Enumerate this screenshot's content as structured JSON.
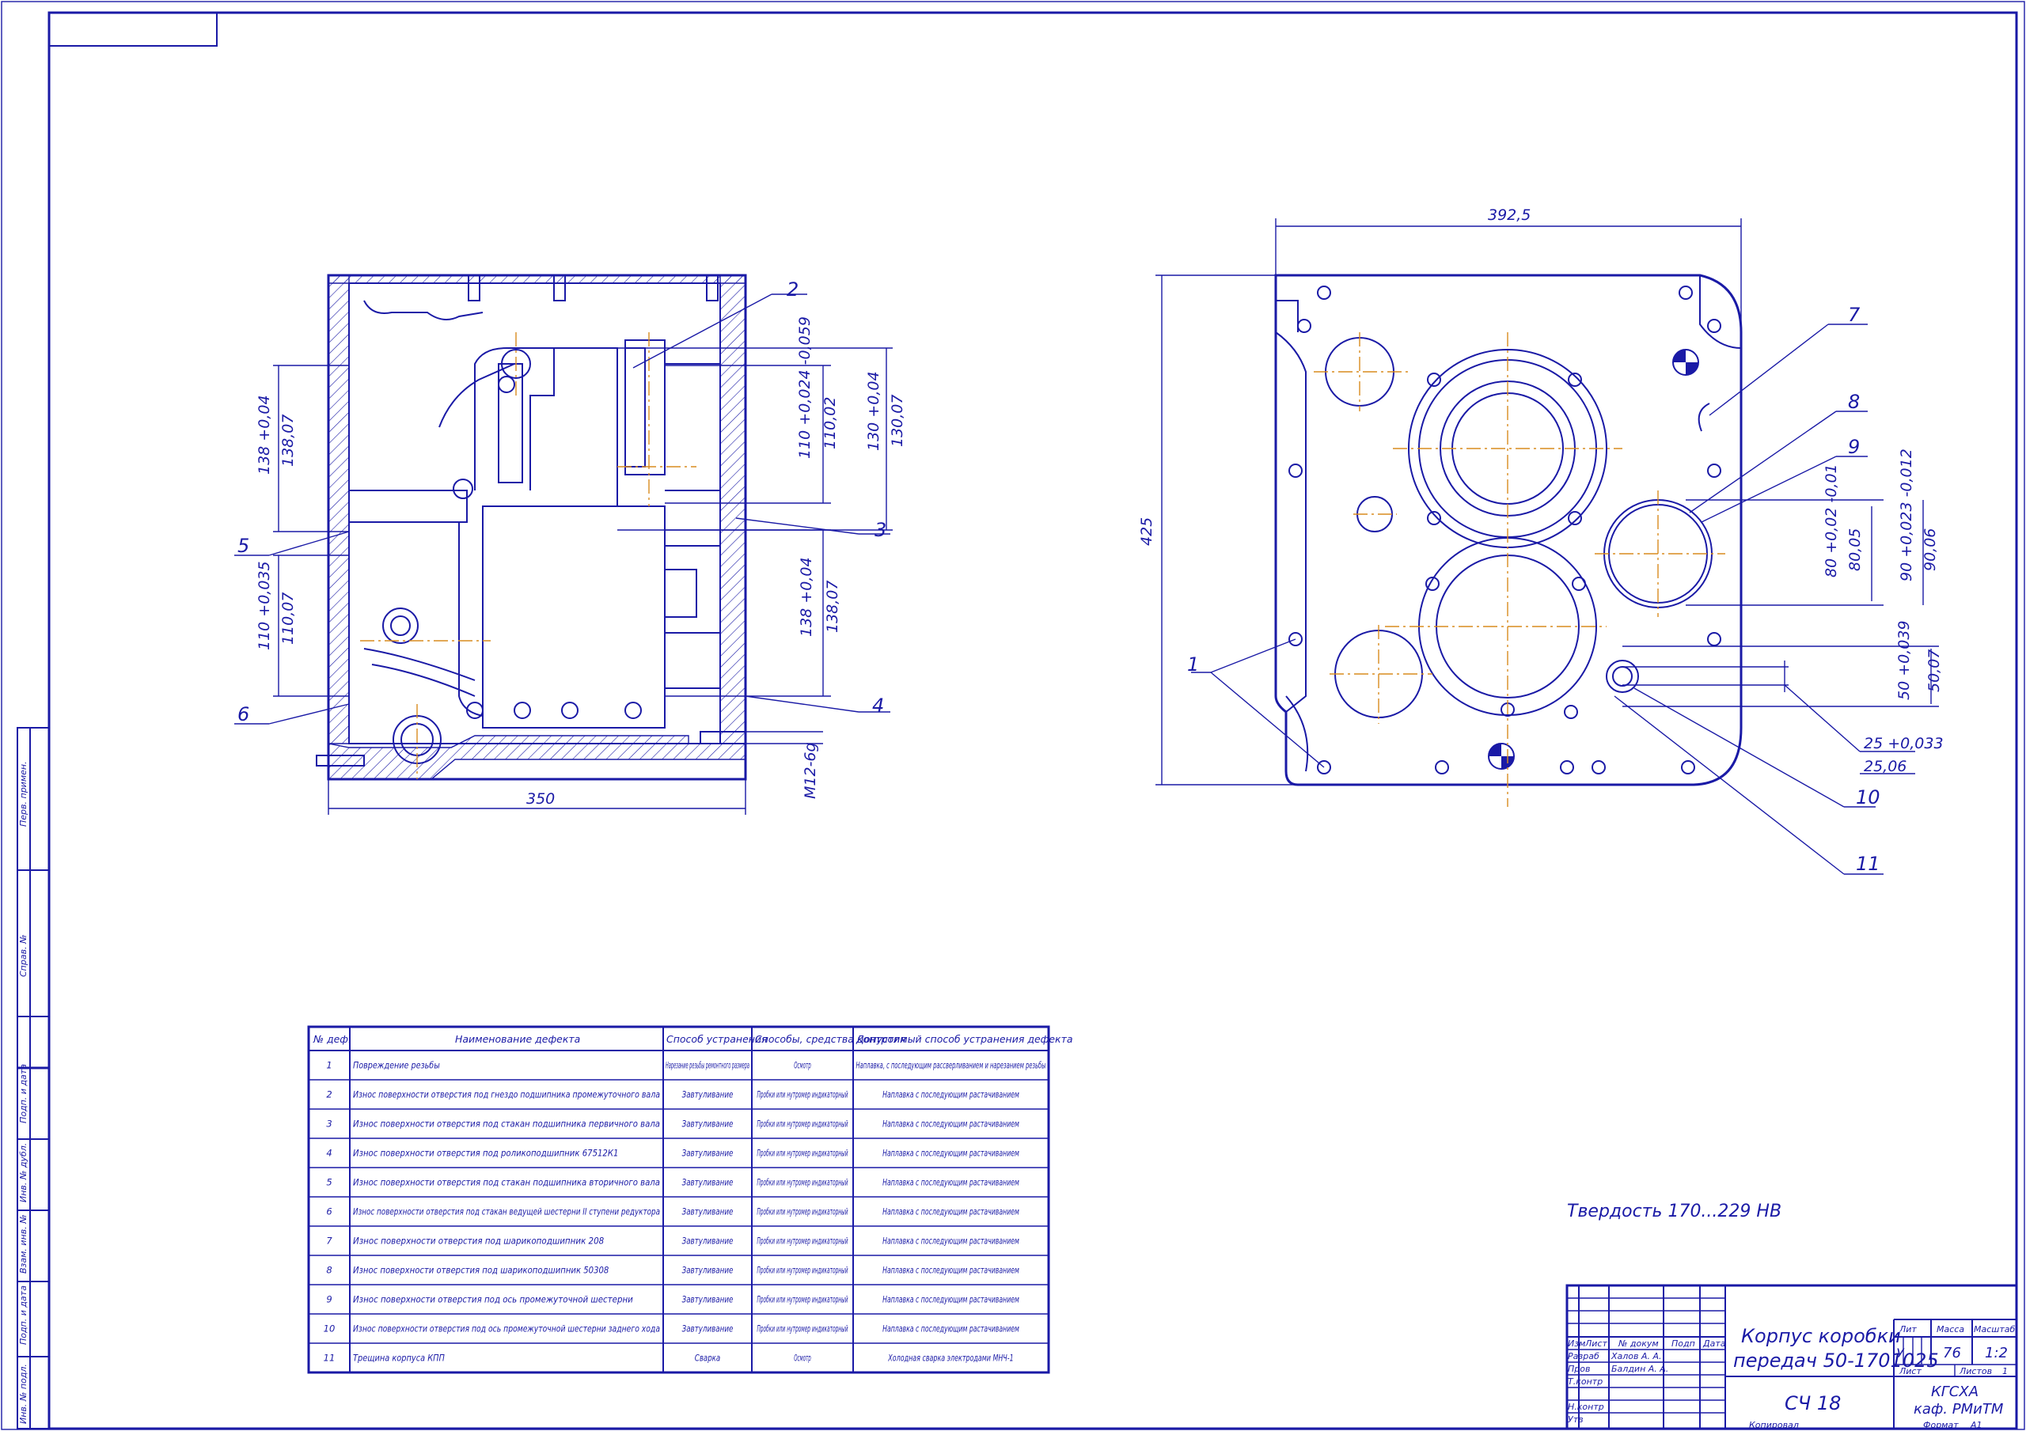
{
  "drawing_title": "Корпус коробки передач 50-1701025",
  "title_line1": "Корпус коробки",
  "title_line2": "передач 50-1701025",
  "material": "СЧ 18",
  "hardness_note": "Твердость 170...229 HB",
  "organization_line1": "КГСХА",
  "organization_line2": "каф. РМиТМ",
  "stamp": {
    "col_izm": "Изм",
    "col_list": "Лист",
    "col_doc": "№ докум",
    "col_podp": "Подп",
    "col_data": "Дата",
    "razrab_label": "Разраб",
    "razrab_name": "Халов А. А.",
    "prov_label": "Пров",
    "prov_name": "Балдин А. А.",
    "tkontr_label": "Т.контр",
    "nkontr_label": "Н.контр",
    "utv_label": "Утв",
    "lit_label": "Лит",
    "lit_value": "У",
    "massa_label": "Масса",
    "massa_value": "76",
    "masshtab_label": "Масштаб",
    "masshtab_value": "1:2",
    "list_label": "Лист",
    "listov_label": "Листов",
    "listov_value": "1",
    "kopiroval": "Копировал",
    "format_label": "Формат",
    "format_value": "А1"
  },
  "side_labels": [
    "Перв. примен.",
    "Справ. №",
    "Подп. и дата",
    "Инв. № дубл.",
    "Взам. инв. №",
    "Подп. и дата",
    "Инв. № подл."
  ],
  "dimensions_left": {
    "width": "350",
    "d138_top_tol": "138 +0,04",
    "d138_top_actual": "138,07",
    "d110_tol": "110 +0,035",
    "d110_actual": "110,07",
    "d110b_tol": "110 +0,024 -0,059",
    "d110b_actual": "110,02",
    "d130_tol": "130 +0,04",
    "d130_actual": "130,07",
    "d138_mid_tol": "138 +0,04",
    "d138_mid_actual": "138,07",
    "thread": "М12-6g"
  },
  "dimensions_right": {
    "width": "392,5",
    "height": "425",
    "d80_tol": "80 +0,02 -0,01",
    "d80_actual": "80,05",
    "d90_tol": "90 +0,023 -0,012",
    "d90_actual": "90,06",
    "d50_tol": "50 +0,039",
    "d50_actual": "50,07",
    "d25_tol": "25 +0,033",
    "d25_actual": "25,06"
  },
  "leaders_left": [
    "2",
    "3",
    "4",
    "5",
    "6"
  ],
  "leaders_right": [
    "1",
    "7",
    "8",
    "9",
    "10",
    "11"
  ],
  "defects_table": {
    "headers": [
      "№ деф.",
      "Наименование дефекта",
      "Способ устранения",
      "Способы, средства контроля",
      "Допустимый способ устранения дефекта"
    ],
    "rows": [
      [
        "1",
        "Повреждение резьбы",
        "Нарезание резьбы ремонтного размера",
        "Осмотр",
        "Наплавка, с последующим рассверливанием и нарезанием резьбы"
      ],
      [
        "2",
        "Износ поверхности отверстия под гнездо подшипника промежуточного вала",
        "Завтуливание",
        "Пробки или нутромер индикаторный",
        "Наплавка с последующим растачиванием"
      ],
      [
        "3",
        "Износ поверхности отверстия под стакан подшипника первичного вала",
        "Завтуливание",
        "Пробки или нутромер индикаторный",
        "Наплавка с последующим растачиванием"
      ],
      [
        "4",
        "Износ поверхности отверстия под роликоподшипник 67512К1",
        "Завтуливание",
        "Пробки или нутромер индикаторный",
        "Наплавка с последующим растачиванием"
      ],
      [
        "5",
        "Износ поверхности отверстия под стакан подшипника вторичного вала",
        "Завтуливание",
        "Пробки или нутромер индикаторный",
        "Наплавка с последующим растачиванием"
      ],
      [
        "6",
        "Износ поверхности отверстия под стакан ведущей шестерни II ступени редуктора",
        "Завтуливание",
        "Пробки или нутромер индикаторный",
        "Наплавка с последующим растачиванием"
      ],
      [
        "7",
        "Износ поверхности отверстия  под шарикоподшипник 208",
        "Завтуливание",
        "Пробки или нутромер индикаторный",
        "Наплавка с последующим растачиванием"
      ],
      [
        "8",
        "Износ поверхности отверстия под шарикоподшипник 50308",
        "Завтуливание",
        "Пробки или нутромер индикаторный",
        "Наплавка с последующим растачиванием"
      ],
      [
        "9",
        "Износ поверхности отверстия под ось промежуточной шестерни",
        "Завтуливание",
        "Пробки или нутромер индикаторный",
        "Наплавка с последующим растачиванием"
      ],
      [
        "10",
        "Износ поверхности отверстия под ось промежуточной шестерни заднего хода",
        "Завтуливание",
        "Пробки или нутромер индикаторный",
        "Наплавка с последующим растачиванием"
      ],
      [
        "11",
        "Трещина корпуса КПП",
        "Сварка",
        "Осмотр",
        "Холодная сварка электродами МНЧ-1"
      ]
    ]
  },
  "colors": {
    "ink": "#1a1aa6",
    "axis": "#d98c1f",
    "paper": "#ffffff"
  }
}
